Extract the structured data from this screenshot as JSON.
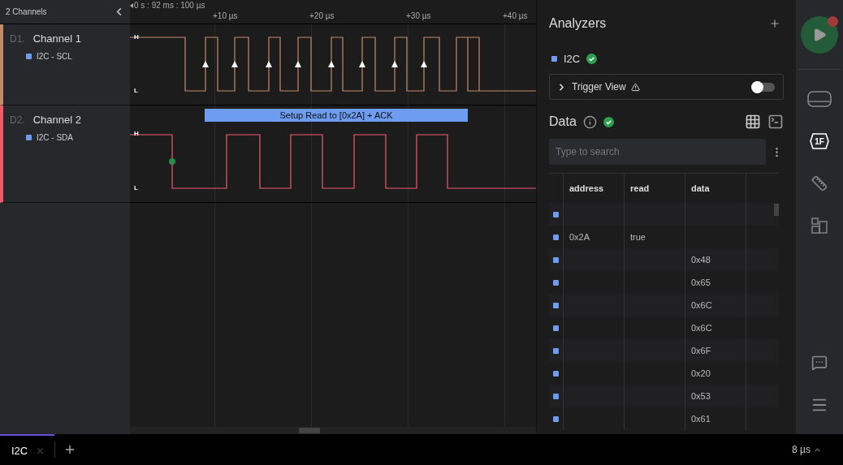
{
  "sidebar": {
    "title": "2 Channels"
  },
  "timeline": {
    "start": "0 s : 92 ms : 100 µs",
    "ticks": [
      "+10 µs",
      "+20 µs",
      "+30 µs",
      "+40 µs"
    ]
  },
  "channels": [
    {
      "index": "D1.",
      "name": "Channel 1",
      "color": "#c58a6c",
      "analyzer": "I2C - SCL",
      "kind": "clock",
      "high_label": "H",
      "low_label": "L"
    },
    {
      "index": "D2.",
      "name": "Channel 2",
      "color": "#f05a6e",
      "analyzer": "I2C - SDA",
      "kind": "data",
      "high_label": "H",
      "low_label": "L",
      "annotation": "Setup Read to [0x2A] + ACK"
    }
  ],
  "analyzers": {
    "title": "Analyzers",
    "items": [
      {
        "name": "I2C",
        "color": "#6d9cf0"
      }
    ],
    "trigger": {
      "label": "Trigger View",
      "on": false
    }
  },
  "data": {
    "title": "Data",
    "search": {
      "placeholder": "Type to search"
    },
    "columns": [
      "address",
      "read",
      "data"
    ],
    "rows": [
      {},
      {
        "address": "0x2A",
        "read": "true"
      },
      {
        "data": "0x48"
      },
      {
        "data": "0x65"
      },
      {
        "data": "0x6C"
      },
      {
        "data": "0x6C"
      },
      {
        "data": "0x6F"
      },
      {
        "data": "0x20"
      },
      {
        "data": "0x53"
      },
      {
        "data": "0x61"
      }
    ]
  },
  "rail": {
    "decoder_label": "1F",
    "recording": true
  },
  "tabs": [
    {
      "label": "I2C",
      "selected": true
    }
  ],
  "status": {
    "zoom": "8 µs"
  }
}
